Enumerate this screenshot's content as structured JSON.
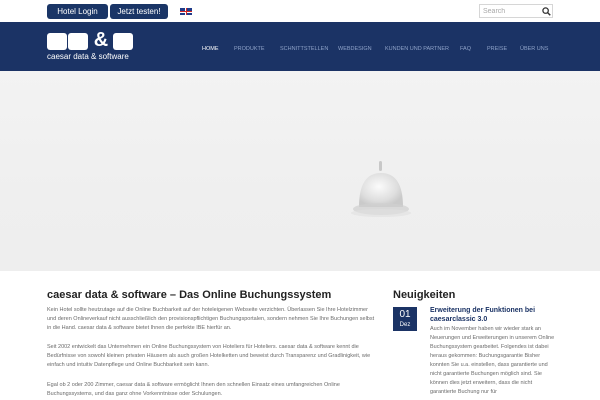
{
  "top_bar": {
    "login_label": "Hotel Login",
    "test_label": "Jetzt testen!",
    "flag_icon": "uk-flag-icon",
    "search_placeholder": "Search",
    "search_icon": "search-icon"
  },
  "header": {
    "logo_text": "caesar data & software",
    "logo_amp": "&",
    "nav": [
      {
        "label": "HOME"
      },
      {
        "label": "PRODUKTE"
      },
      {
        "label": "SCHNITTSTELLEN"
      },
      {
        "label": "WEBDESIGN"
      },
      {
        "label": "KUNDEN UND PARTNER"
      },
      {
        "label": "FAQ"
      },
      {
        "label": "PREISE"
      },
      {
        "label": "ÜBER UNS"
      }
    ]
  },
  "main": {
    "title": "caesar data & software – Das Online Buchungssystem",
    "paragraphs": [
      "Kein Hotel sollte heutzutage auf die Online Buchbarkeit auf der hoteleigenen Webseite verzichten. Überlassen Sie Ihre Hotelzimmer und deren Onlineverkauf nicht ausschließlich den provisionspflichtigen Buchungsportalen, sondern nehmen Sie Ihre Buchungen selbst in die Hand. caesar data & software bietet Ihnen die perfekte IBE hierfür an.",
      "Seit 2002 entwickelt das Unternehmen ein Online Buchungssystem von Hoteliers für Hoteliers. caesar data & software kennt die Bedürfnisse von sowohl kleinen privaten Häusern als auch großen Hotelketten und beweist durch Transparenz und Gradlinigkeit, wie einfach und intuitiv Datenpflege und Online Buchbarkeit sein kann.",
      "Egal ob 2 oder 200 Zimmer, caesar data & software ermöglicht Ihnen den schnellen Einsatz eines umfangreichen Online Buchungssystems, und das ganz ohne Vorkenntnisse oder Schulungen."
    ]
  },
  "news": {
    "heading": "Neuigkeiten",
    "date_day": "01",
    "date_month": "Dez",
    "item_title": "Erweiterung der Funktionen bei caesarclassic 3.0",
    "item_text": "Auch im November haben wir wieder stark an Neuerungen und Erweiterungen in unserem Online Buchungssystem gearbeitet. Folgendes ist dabei heraus gekommen: Buchungsgarantie Bisher konnten Sie u.a. einstellen, dass garantierte und nicht garantierte Buchungen möglich sind. Sie können dies jetzt erweitern, dass die nicht garantierte Buchung nur für"
  },
  "colors": {
    "brand_navy": "#1b3365",
    "button_navy": "#1a3566",
    "nav_inactive": "#8ea2c8",
    "hero_bg": "#f0f0f0"
  }
}
